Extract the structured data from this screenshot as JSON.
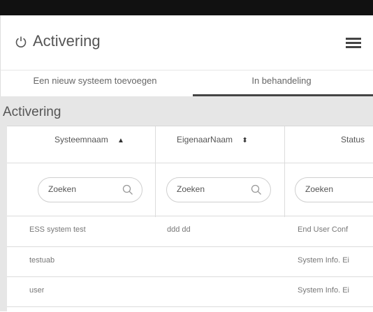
{
  "header": {
    "title": "Activering",
    "power_icon": "power-icon",
    "menu_icon": "hamburger-menu-icon"
  },
  "tabs": [
    {
      "label": "Een nieuw systeem toevoegen",
      "active": false
    },
    {
      "label": "In behandeling",
      "active": true
    }
  ],
  "section": {
    "title": "Activering"
  },
  "table": {
    "columns": [
      {
        "label": "Systeemnaam",
        "sort": "ascending",
        "sort_icon": "sort-asc-icon"
      },
      {
        "label": "EigenaarNaam",
        "sort": "both",
        "sort_icon": "sort-both-icon"
      },
      {
        "label": "Status"
      }
    ],
    "search_placeholder": "Zoeken",
    "rows": [
      [
        "ESS system test",
        "ddd dd",
        "End User Conf"
      ],
      [
        "testuab",
        "",
        "System Info. Ei"
      ],
      [
        "user",
        "",
        "System Info. Ei"
      ]
    ]
  },
  "colors": {
    "topbar": "#111111",
    "content_bg": "#e6e6e6",
    "tab_active_underline": "#444444"
  }
}
